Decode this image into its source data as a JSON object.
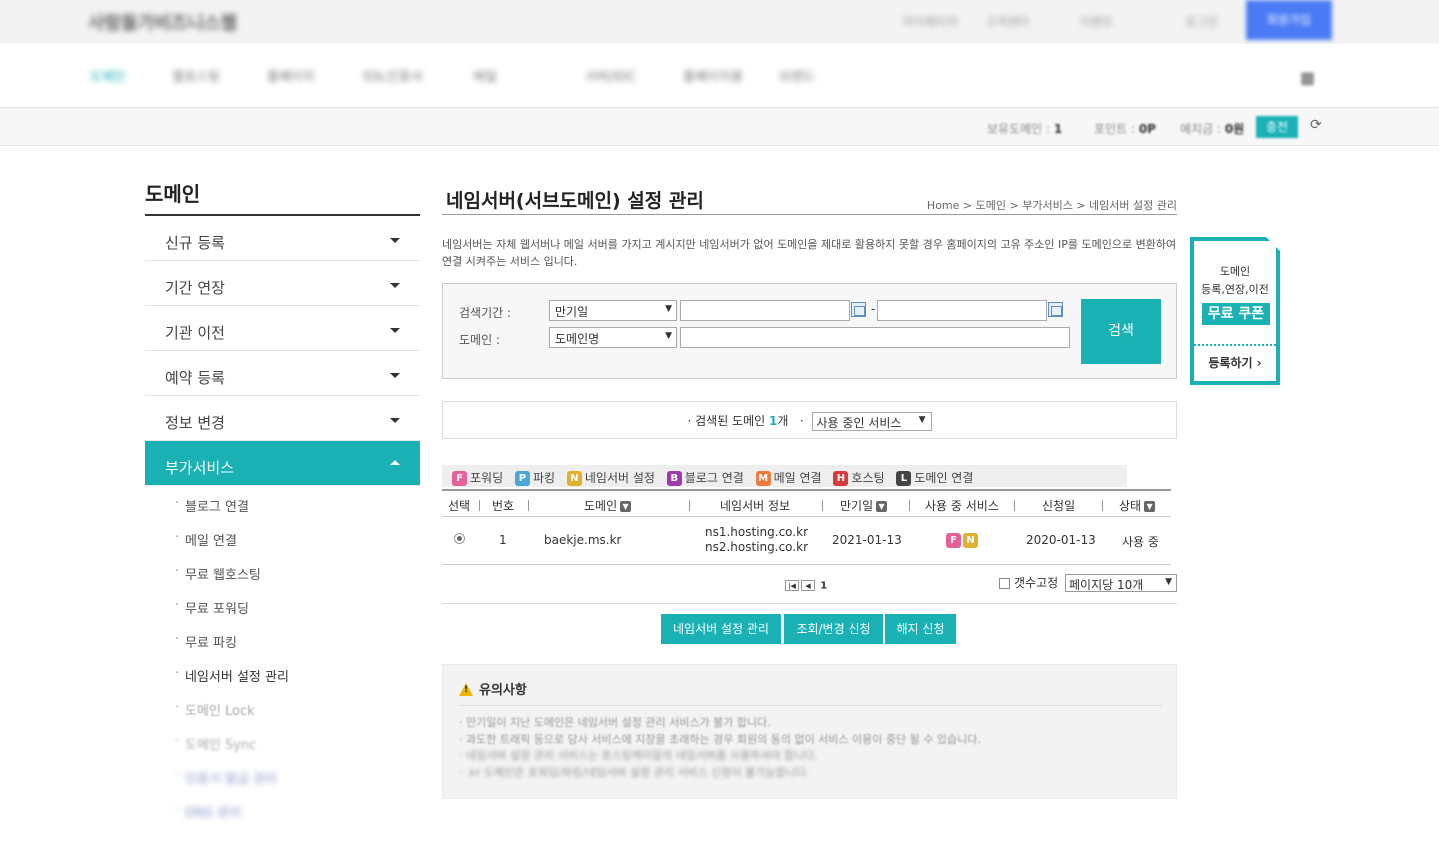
{
  "header": {
    "logo": "사람들가비즈니스웹",
    "util_links": [
      "마이페이지",
      "고객센터",
      "이벤트",
      "로그인"
    ],
    "signup_button": "회원가입"
  },
  "gnb": {
    "items": [
      "도메인",
      "웹호스팅",
      "홈페이지",
      "SSL인증서",
      "메일",
      "서버/IDC",
      "홈페이지봉",
      "브랜드"
    ]
  },
  "infobar": {
    "owned_label": "보유도메인 :",
    "owned_value": "1",
    "point_label": "포인트 :",
    "point_value": "0P",
    "deposit_label": "예치금 :",
    "deposit_value": "0원",
    "charge": "충전",
    "refresh_icon": "refresh-icon"
  },
  "sidebar": {
    "title": "도메인",
    "items": [
      {
        "label": "신규 등록"
      },
      {
        "label": "기간 연장"
      },
      {
        "label": "기관 이전"
      },
      {
        "label": "예약 등록"
      },
      {
        "label": "정보 변경"
      },
      {
        "label": "부가서비스"
      }
    ],
    "sub_items": [
      "블로그 연결",
      "메일 연결",
      "무료 웹호스팅",
      "무료 포워딩",
      "무료 파킹",
      "네임서버 설정 관리",
      "도메인 Lock",
      "도메인 Sync",
      "인증서 발급 관리",
      "DNS 관리"
    ]
  },
  "main": {
    "title": "네임서버(서브도메인) 설정 관리",
    "breadcrumb": [
      "Home",
      "도메인",
      "부가서비스",
      "네임서버 설정 관리"
    ],
    "description": "네임서버는 자체 웹서버나 메일 서버를 가지고 계시지만 네임서버가 없어 도메인을 제대로 활용하지 못할 경우 홈페이지의 고유 주소인 IP를 도메인으로 변환하여 연결 시켜주는 서비스 입니다.",
    "search": {
      "period_label": "검색기간 :",
      "period_select": "만기일",
      "domain_label": "도메인 :",
      "domain_select": "도메인명",
      "dash": "-",
      "button": "검색"
    },
    "result": {
      "prefix": "· 검색된 도메인",
      "count": "1",
      "unit": "개",
      "filter_prefix": "·",
      "filter_select": "사용 중인 서비스"
    },
    "legend": [
      {
        "badge": "F",
        "label": "포워딩",
        "color": "#e8609a"
      },
      {
        "badge": "P",
        "label": "파킹",
        "color": "#4aa8d8"
      },
      {
        "badge": "N",
        "label": "네임서버 설정",
        "color": "#e0b030"
      },
      {
        "badge": "B",
        "label": "블로그 연결",
        "color": "#9b3aa8"
      },
      {
        "badge": "M",
        "label": "메일 연결",
        "color": "#f07a3a"
      },
      {
        "badge": "H",
        "label": "호스팅",
        "color": "#d63a3a"
      },
      {
        "badge": "L",
        "label": "도메인 연결",
        "color": "#444444"
      }
    ],
    "table": {
      "headers": [
        "선택",
        "번호",
        "도메인",
        "네임서버 정보",
        "만기일",
        "사용 중 서비스",
        "신청일",
        "상태"
      ],
      "rows": [
        {
          "no": "1",
          "domain": "baekje.ms.kr",
          "ns1": "ns1.hosting.co.kr",
          "ns2": "ns2.hosting.co.kr",
          "expire": "2021-01-13",
          "services": [
            "F",
            "N"
          ],
          "applied": "2020-01-13",
          "status": "사용 중"
        }
      ]
    },
    "pager": {
      "first": "⏮",
      "prev": "◀",
      "current": "1"
    },
    "fix_label": "갯수고정",
    "per_page": "페이지당 10개",
    "actions": [
      "네임서버 설정 관리",
      "조회/변경 신청",
      "해지 신청"
    ],
    "notice": {
      "title": "유의사항",
      "items": [
        "만기일이 지난 도메인은 네임서버 설정 관리 서비스가 불가 합니다.",
        "과도한 트래픽 등으로 당사 서비스에 지장을 초래하는 경우 회원의 동의 없이 서비스 이용이 중단 될 수 있습니다.",
        "네임서버 설정 관리 서비스는 호스팅케이알의 네임서버를 사용하셔야 합니다.",
        ".kr 도메인은 포워딩/파킹/네임서버 설정 관리 서비스 신청이 불가능합니다."
      ]
    }
  },
  "coupon": {
    "line1": "도메인",
    "line2": "등록,연장,이전",
    "highlight": "무료 쿠폰",
    "cta": "등록하기 ›"
  }
}
